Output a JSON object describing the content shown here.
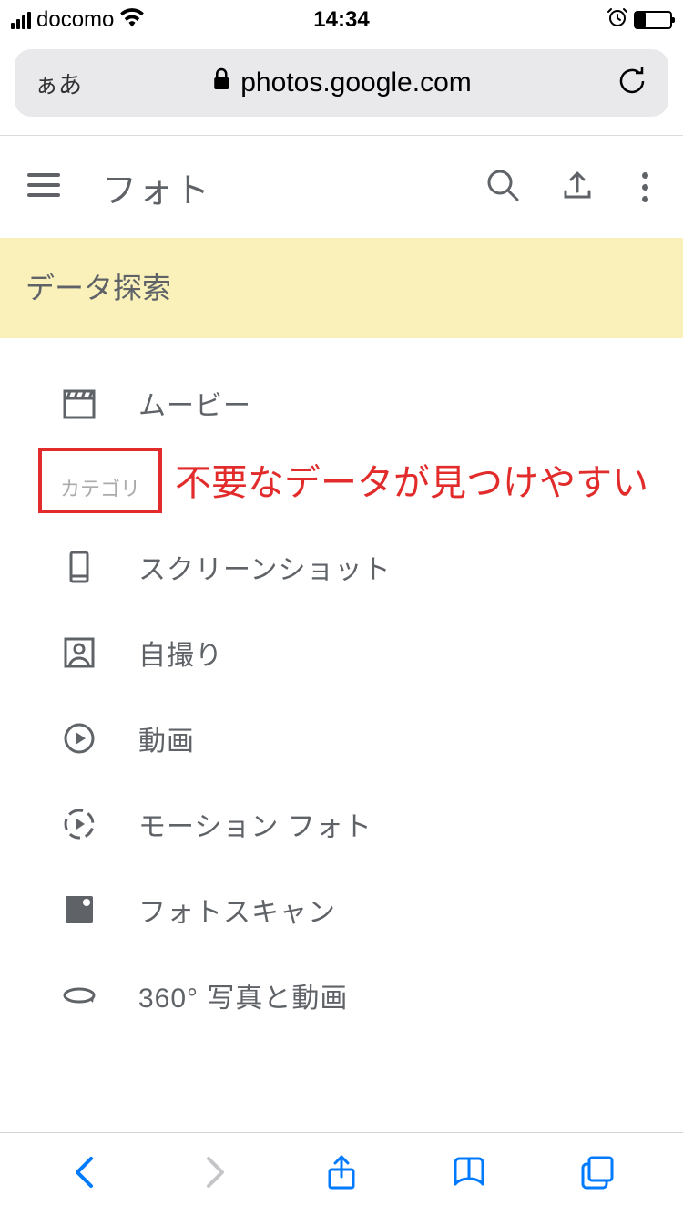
{
  "status": {
    "carrier": "docomo",
    "time": "14:34"
  },
  "urlbar": {
    "readerMode": "ぁあ",
    "domain": "photos.google.com"
  },
  "header": {
    "title": "フォト"
  },
  "banner": {
    "text": "データ探索"
  },
  "movies": {
    "label": "ムービー"
  },
  "section": {
    "label": "カテゴリ"
  },
  "annotation": {
    "text": "不要なデータが見つけやすい"
  },
  "categories": [
    {
      "label": "スクリーンショット"
    },
    {
      "label": "自撮り"
    },
    {
      "label": "動画"
    },
    {
      "label": "モーション フォト"
    },
    {
      "label": "フォトスキャン"
    },
    {
      "label": "360° 写真と動画"
    }
  ]
}
